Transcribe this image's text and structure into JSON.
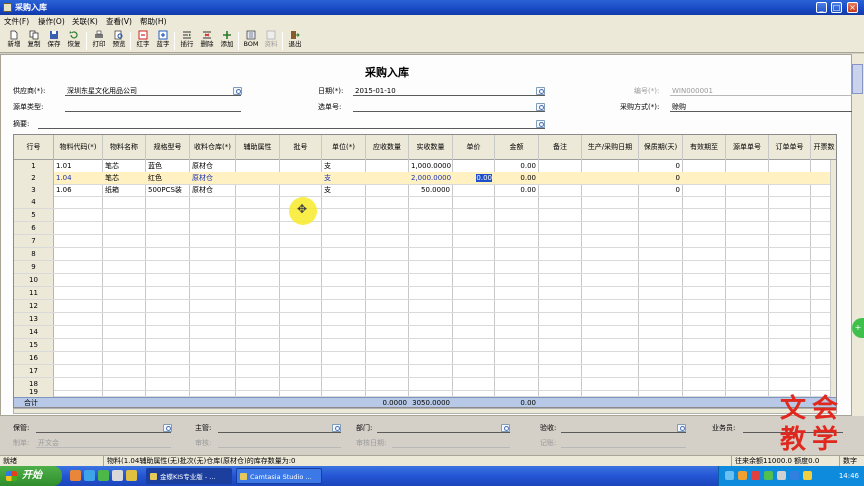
{
  "window": {
    "title": "采购入库",
    "controls": [
      "_",
      "□",
      "×"
    ]
  },
  "menu": [
    "文件(F)",
    "操作(O)",
    "关联(K)",
    "查看(V)",
    "帮助(H)"
  ],
  "toolbar": [
    {
      "label": "新增",
      "icon": "new-doc-icon",
      "enabled": true
    },
    {
      "label": "复制",
      "icon": "copy-icon",
      "enabled": true
    },
    {
      "label": "保存",
      "icon": "save-icon",
      "enabled": true
    },
    {
      "label": "恢复",
      "icon": "restore-icon",
      "enabled": true
    },
    {
      "label": "打印",
      "icon": "print-icon",
      "enabled": true
    },
    {
      "label": "预览",
      "icon": "preview-icon",
      "enabled": true
    },
    {
      "label": "红字",
      "icon": "red-text-icon",
      "enabled": true
    },
    {
      "label": "蓝字",
      "icon": "blue-text-icon",
      "enabled": true
    },
    {
      "label": "插行",
      "icon": "insert-row-icon",
      "enabled": true
    },
    {
      "label": "删除",
      "icon": "delete-row-icon",
      "enabled": true
    },
    {
      "label": "添加",
      "icon": "add-icon",
      "enabled": true
    },
    {
      "label": "BOM",
      "icon": "bom-icon",
      "enabled": true
    },
    {
      "label": "资料",
      "icon": "data-icon",
      "enabled": false
    },
    {
      "label": "退出",
      "icon": "exit-icon",
      "enabled": true
    }
  ],
  "form": {
    "title": "采购入库",
    "supplier": {
      "label": "供应商(*):",
      "value": "深圳东星文化用品公司"
    },
    "date": {
      "label": "日期(*):",
      "value": "2015-01-10"
    },
    "number": {
      "label": "编号(*):",
      "value": "WIN000001"
    },
    "source_type": {
      "label": "源单类型:",
      "value": ""
    },
    "select_number": {
      "label": "选单号:",
      "value": ""
    },
    "purchase_method": {
      "label": "采购方式(*):",
      "value": "赊购"
    },
    "summary": {
      "label": "摘要:",
      "value": ""
    }
  },
  "grid": {
    "headers": [
      "行号",
      "物料代码(*)",
      "物料名称",
      "规格型号",
      "收料仓库(*)",
      "辅助属性",
      "批号",
      "单位(*)",
      "应收数量",
      "实收数量",
      "单价",
      "金额",
      "备注",
      "生产/采购日期",
      "保质期(天)",
      "有效期至",
      "源单单号",
      "订单单号",
      "开票数"
    ],
    "row_numbers": [
      "1",
      "2",
      "3",
      "4",
      "5",
      "6",
      "7",
      "8",
      "9",
      "10",
      "11",
      "12",
      "13",
      "14",
      "15",
      "16",
      "17",
      "18",
      "19"
    ],
    "rows": [
      [
        "1.01",
        "笔芯",
        "蓝色",
        "原材仓",
        "",
        "",
        "支",
        "",
        "1,000.0000",
        "",
        "0.00",
        "",
        "",
        "0"
      ],
      [
        "1.04",
        "笔芯",
        "红色",
        "原材仓",
        "",
        "",
        "支",
        "",
        "2,000.0000",
        "0.00",
        "0.00",
        "",
        "",
        "0"
      ],
      [
        "1.06",
        "纸箱",
        "500PCS装",
        "原材仓",
        "",
        "",
        "支",
        "",
        "50.0000",
        "",
        "0.00",
        "",
        "",
        "0"
      ]
    ],
    "total": {
      "label": "合计",
      "receivable_qty": "0.0000",
      "received_qty": "3050.0000",
      "amount": "0.00"
    }
  },
  "footer": {
    "custodian": {
      "label": "保管:",
      "value": ""
    },
    "supervisor": {
      "label": "主管:",
      "value": ""
    },
    "department": {
      "label": "部门:",
      "value": ""
    },
    "inspector": {
      "label": "验收:",
      "value": ""
    },
    "salesperson": {
      "label": "业务员:",
      "value": ""
    },
    "maker": {
      "label": "制单:",
      "value": "开文会"
    },
    "auditor": {
      "label": "审核:",
      "value": ""
    },
    "audit_date": {
      "label": "审核日期:",
      "value": ""
    },
    "bookkeeping": {
      "label": "记账:",
      "value": ""
    }
  },
  "status": {
    "left": "就绪",
    "message": "物料(1.04辅助属性(无)批次(无)仓库(原材仓)的库存数量为:0",
    "right": "往来余额11000.0 额度0.0",
    "extra": "数字"
  },
  "watermark": [
    "文",
    "会",
    "教",
    "学"
  ],
  "taskbar": {
    "start": "开始",
    "tasks": [
      "金蝶KIS专业版 - ...",
      "Camtasia Studio ..."
    ],
    "clock": "14:46"
  },
  "colors": {
    "accent": "#2456c8",
    "row_selected": "#fff1c2",
    "total_row": "#b7c9e6",
    "watermark": "#e0281e"
  }
}
